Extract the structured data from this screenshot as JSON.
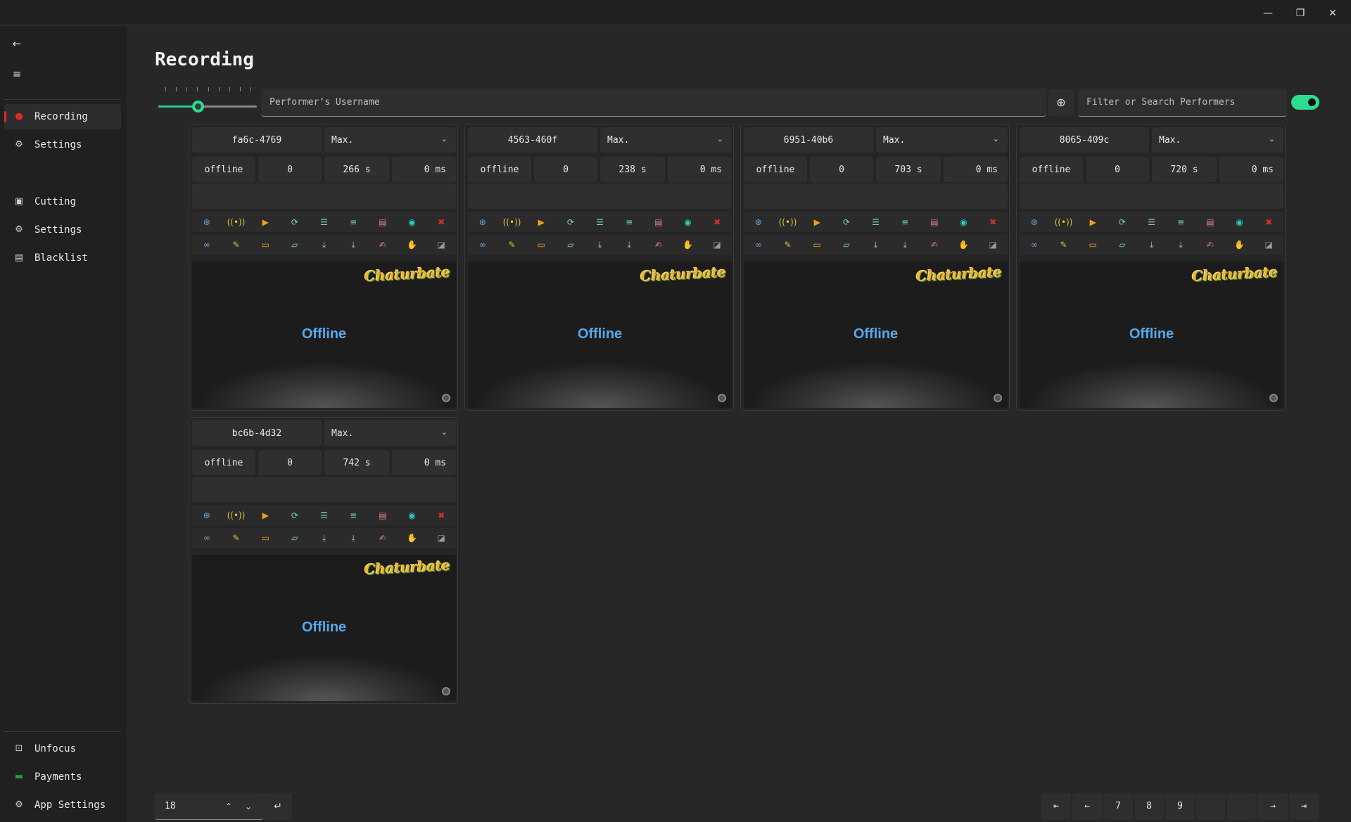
{
  "window": {
    "minimize": "—",
    "maximize": "❐",
    "close": "✕"
  },
  "sidebar": {
    "back_icon": "←",
    "menu_icon": "≡",
    "items": [
      {
        "label": "Recording",
        "icon": "record-icon"
      },
      {
        "label": "Settings",
        "icon": "gear-icon"
      },
      {
        "label": "Cutting",
        "icon": "cut-icon"
      },
      {
        "label": "Settings",
        "icon": "gear-icon"
      },
      {
        "label": "Blacklist",
        "icon": "blacklist-icon"
      }
    ],
    "footer": [
      {
        "label": "Unfocus",
        "icon": "unfocus-icon"
      },
      {
        "label": "Payments",
        "icon": "payments-icon"
      },
      {
        "label": "App Settings",
        "icon": "gear-icon"
      }
    ]
  },
  "page": {
    "title": "Recording"
  },
  "toolbar": {
    "username_placeholder": "Performer’s Username",
    "filter_placeholder": "Filter or Search Performers",
    "add_icon": "⊕",
    "slider_level": 0.4,
    "toggle_on": true
  },
  "cards": [
    {
      "id": "fa6c-4769",
      "quality": "Max.",
      "status": "offline",
      "count": "0",
      "duration": "266 s",
      "latency": "0 ms",
      "platform": "Chaturbate",
      "preview_status": "Offline"
    },
    {
      "id": "4563-460f",
      "quality": "Max.",
      "status": "offline",
      "count": "0",
      "duration": "238 s",
      "latency": "0 ms",
      "platform": "Chaturbate",
      "preview_status": "Offline"
    },
    {
      "id": "6951-40b6",
      "quality": "Max.",
      "status": "offline",
      "count": "0",
      "duration": "703 s",
      "latency": "0 ms",
      "platform": "Chaturbate",
      "preview_status": "Offline"
    },
    {
      "id": "8065-409c",
      "quality": "Max.",
      "status": "offline",
      "count": "0",
      "duration": "720 s",
      "latency": "0 ms",
      "platform": "Chaturbate",
      "preview_status": "Offline"
    },
    {
      "id": "bc6b-4d32",
      "quality": "Max.",
      "status": "offline",
      "count": "0",
      "duration": "742 s",
      "latency": "0 ms",
      "platform": "Chaturbate",
      "preview_status": "Offline"
    }
  ],
  "icon_row_1": [
    {
      "name": "compass-icon",
      "glyph": "⊛",
      "color": "#6fa8dc"
    },
    {
      "name": "broadcast-icon",
      "glyph": "((•))",
      "color": "#e0c430"
    },
    {
      "name": "play-icon",
      "glyph": "▶",
      "color": "#f0a020"
    },
    {
      "name": "file-refresh-icon",
      "glyph": "⟳",
      "color": "#7fdfa0"
    },
    {
      "name": "list-icon",
      "glyph": "☰",
      "color": "#7fdfa0"
    },
    {
      "name": "list-settings-icon",
      "glyph": "≡",
      "color": "#7fdfa0"
    },
    {
      "name": "file-remove-icon",
      "glyph": "▤",
      "color": "#e08080"
    },
    {
      "name": "record-icon",
      "glyph": "◉",
      "color": "#2ad0c0"
    },
    {
      "name": "delete-icon",
      "glyph": "✖",
      "color": "#d03030"
    }
  ],
  "icon_row_2": [
    {
      "name": "infinity-icon",
      "glyph": "∞",
      "color": "#6fa8dc"
    },
    {
      "name": "wrench-icon",
      "glyph": "✎",
      "color": "#e0c430"
    },
    {
      "name": "folder-icon",
      "glyph": "▭",
      "color": "#f0a020"
    },
    {
      "name": "folder-open-icon",
      "glyph": "▱",
      "color": "#7fdfa0"
    },
    {
      "name": "download-icon",
      "glyph": "⤓",
      "color": "#7fdfa0"
    },
    {
      "name": "download-all-icon",
      "glyph": "⤓",
      "color": "#7fdfa0"
    },
    {
      "name": "note-icon",
      "glyph": "✍",
      "color": "#e08080"
    },
    {
      "name": "hand-icon",
      "glyph": "✋",
      "color": "#9a9a9a"
    },
    {
      "name": "sticky-note-icon",
      "glyph": "◪",
      "color": "#9a9a9a"
    }
  ],
  "pager": {
    "per_page": "18",
    "up": "⌃",
    "down": "⌄",
    "enter": "↵",
    "first": "⇤",
    "prev": "←",
    "pages": [
      "7",
      "8",
      "9"
    ],
    "next": "→",
    "last": "⇥"
  }
}
